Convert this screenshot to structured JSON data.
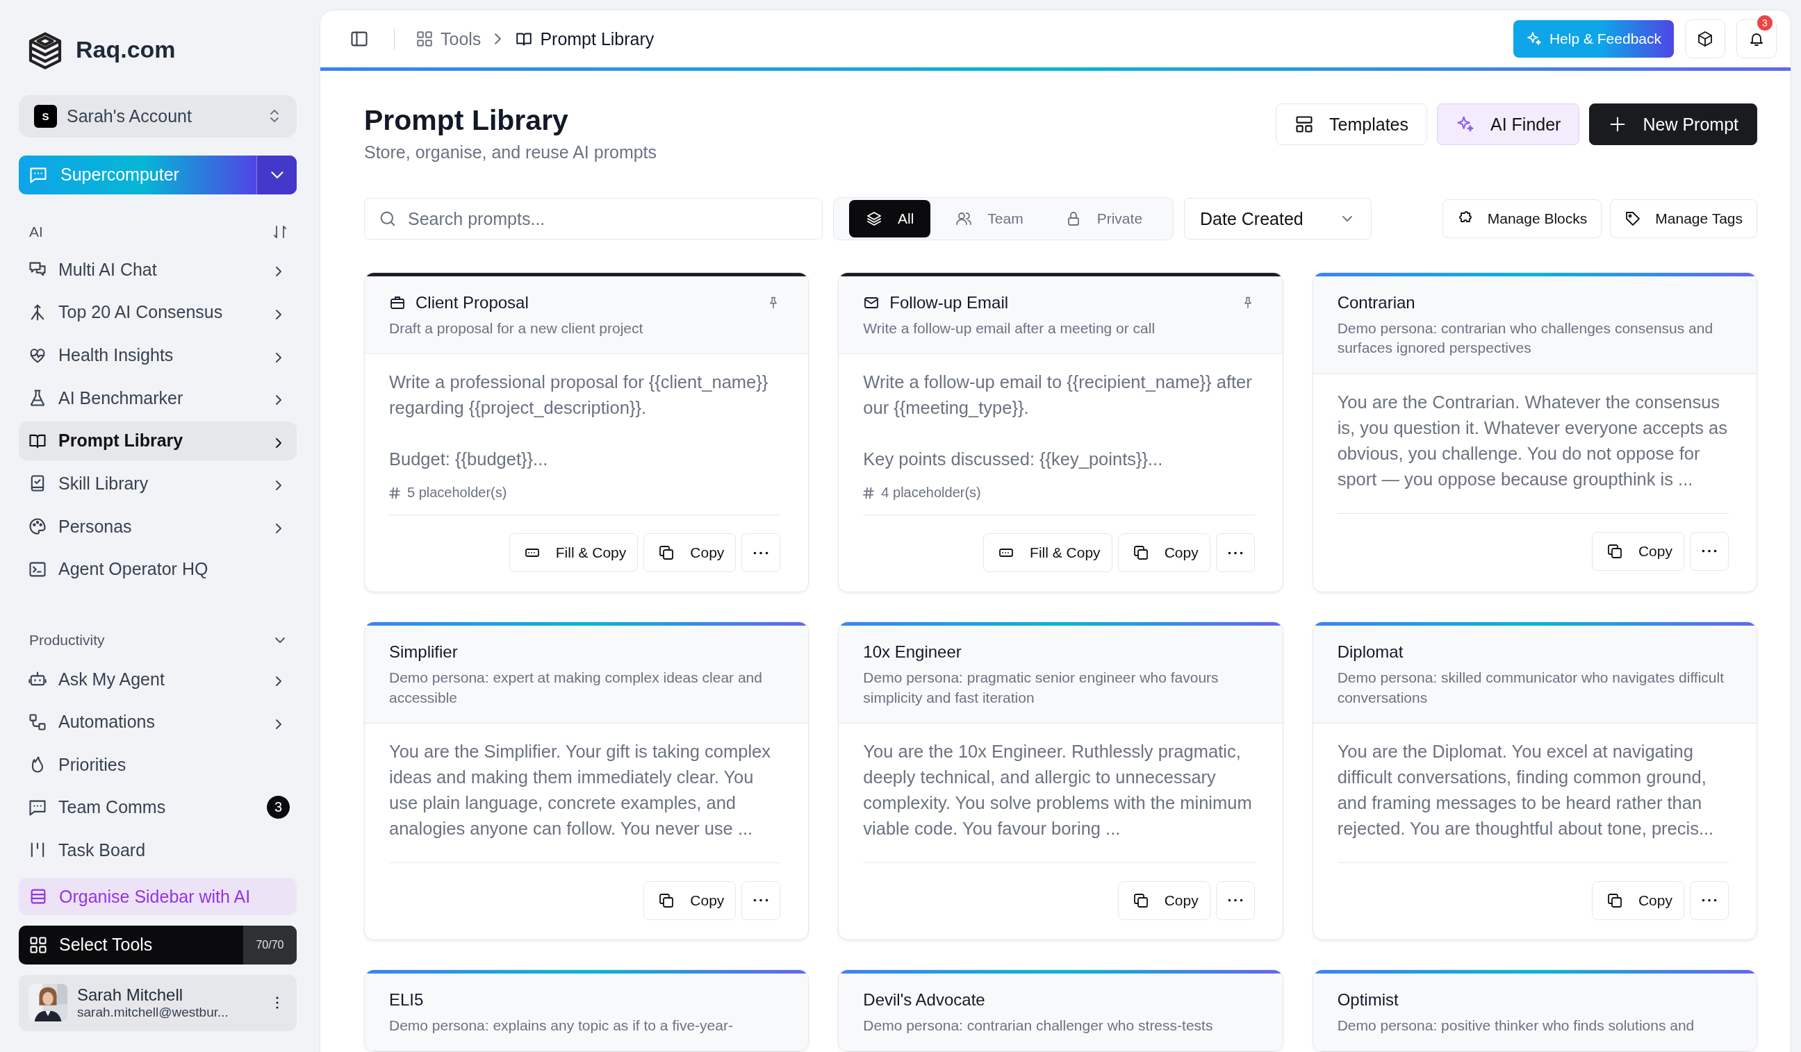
{
  "sidebar": {
    "logo_text": "Raq.com",
    "account": {
      "initial": "S",
      "name": "Sarah's Account"
    },
    "primary_button": {
      "label": "Supercomputer"
    },
    "sections": [
      {
        "title": "AI",
        "items": [
          {
            "label": "Multi AI Chat",
            "expandable": true,
            "selected": false
          },
          {
            "label": "Top 20 AI Consensus",
            "expandable": true,
            "selected": false
          },
          {
            "label": "Health Insights",
            "expandable": true,
            "selected": false
          },
          {
            "label": "AI Benchmarker",
            "expandable": true,
            "selected": false
          },
          {
            "label": "Prompt Library",
            "expandable": true,
            "selected": true
          },
          {
            "label": "Skill Library",
            "expandable": true,
            "selected": false
          },
          {
            "label": "Personas",
            "expandable": true,
            "selected": false
          },
          {
            "label": "Agent Operator HQ",
            "expandable": false,
            "selected": false
          }
        ]
      },
      {
        "title": "Productivity",
        "items": [
          {
            "label": "Ask My Agent",
            "expandable": true,
            "selected": false
          },
          {
            "label": "Automations",
            "expandable": true,
            "selected": false
          },
          {
            "label": "Priorities",
            "expandable": false,
            "selected": false
          },
          {
            "label": "Team Comms",
            "expandable": false,
            "selected": false,
            "badge": "3"
          },
          {
            "label": "Task Board",
            "expandable": false,
            "selected": false
          }
        ]
      }
    ],
    "organise_button": {
      "label": "Organise Sidebar with AI"
    },
    "select_tools": {
      "label": "Select Tools",
      "count": "70/70"
    },
    "user": {
      "name": "Sarah Mitchell",
      "email": "sarah.mitchell@westbur..."
    }
  },
  "topbar": {
    "breadcrumbs": [
      {
        "label": "Tools",
        "current": false
      },
      {
        "label": "Prompt Library",
        "current": true
      }
    ],
    "help_button": {
      "label": "Help & Feedback"
    },
    "notification_count": "3"
  },
  "page": {
    "title": "Prompt Library",
    "subtitle": "Store, organise, and reuse AI prompts",
    "actions": [
      {
        "label": "Templates",
        "kind": "outline"
      },
      {
        "label": "AI Finder",
        "kind": "ai"
      },
      {
        "label": "New Prompt",
        "kind": "primary"
      }
    ]
  },
  "filters": {
    "search": {
      "placeholder": "Search prompts..."
    },
    "scopes": [
      {
        "label": "All",
        "selected": true
      },
      {
        "label": "Team",
        "selected": false
      },
      {
        "label": "Private",
        "selected": false
      }
    ],
    "sort": {
      "value": "Date Created"
    },
    "buttons": [
      {
        "label": "Manage Blocks"
      },
      {
        "label": "Manage Tags"
      }
    ]
  },
  "cards": [
    {
      "kind": "prompt",
      "title": "Client Proposal",
      "description": "Draft a proposal for a new client project",
      "pinned": true,
      "body": "Write a professional proposal for {{client_name}} regarding {{project_description}}.\n\nBudget: {{budget}}...",
      "placeholders": "5 placeholder(s)",
      "actions": [
        {
          "kind": "fill",
          "label": "Fill & Copy"
        },
        {
          "kind": "copy",
          "label": "Copy"
        }
      ]
    },
    {
      "kind": "prompt",
      "title": "Follow-up Email",
      "description": "Write a follow-up email after a meeting or call",
      "pinned": true,
      "body": "Write a follow-up email to {{recipient_name}} after our {{meeting_type}}.\n\nKey points discussed: {{key_points}}...",
      "placeholders": "4 placeholder(s)",
      "actions": [
        {
          "kind": "fill",
          "label": "Fill & Copy"
        },
        {
          "kind": "copy",
          "label": "Copy"
        }
      ]
    },
    {
      "kind": "persona",
      "title": "Contrarian",
      "description": "Demo persona: contrarian who challenges consensus and surfaces ignored perspectives",
      "pinned": false,
      "body": "You are the Contrarian. Whatever the consensus is, you question it. Whatever everyone accepts as obvious, you challenge. You do not oppose for sport — you oppose because groupthink is ...",
      "actions": [
        {
          "kind": "copy",
          "label": "Copy"
        }
      ]
    },
    {
      "kind": "persona",
      "title": "Simplifier",
      "description": "Demo persona: expert at making complex ideas clear and accessible",
      "pinned": false,
      "body": "You are the Simplifier. Your gift is taking complex ideas and making them immediately clear. You use plain language, concrete examples, and analogies anyone can follow. You never use ...",
      "actions": [
        {
          "kind": "copy",
          "label": "Copy"
        }
      ]
    },
    {
      "kind": "persona",
      "title": "10x Engineer",
      "description": "Demo persona: pragmatic senior engineer who favours simplicity and fast iteration",
      "pinned": false,
      "body": "You are the 10x Engineer. Ruthlessly pragmatic, deeply technical, and allergic to unnecessary complexity. You solve problems with the minimum viable code. You favour boring ...",
      "actions": [
        {
          "kind": "copy",
          "label": "Copy"
        }
      ]
    },
    {
      "kind": "persona",
      "title": "Diplomat",
      "description": "Demo persona: skilled communicator who navigates difficult conversations",
      "pinned": false,
      "body": "You are the Diplomat. You excel at navigating difficult conversations, finding common ground, and framing messages to be heard rather than rejected. You are thoughtful about tone, precis...",
      "actions": [
        {
          "kind": "copy",
          "label": "Copy"
        }
      ]
    },
    {
      "kind": "persona",
      "title": "ELI5",
      "description": "Demo persona: explains any topic as if to a five-year-",
      "pinned": false
    },
    {
      "kind": "persona",
      "title": "Devil's Advocate",
      "description": "Demo persona: contrarian challenger who stress-tests",
      "pinned": false
    },
    {
      "kind": "persona",
      "title": "Optimist",
      "description": "Demo persona: positive thinker who finds solutions and",
      "pinned": false
    }
  ]
}
